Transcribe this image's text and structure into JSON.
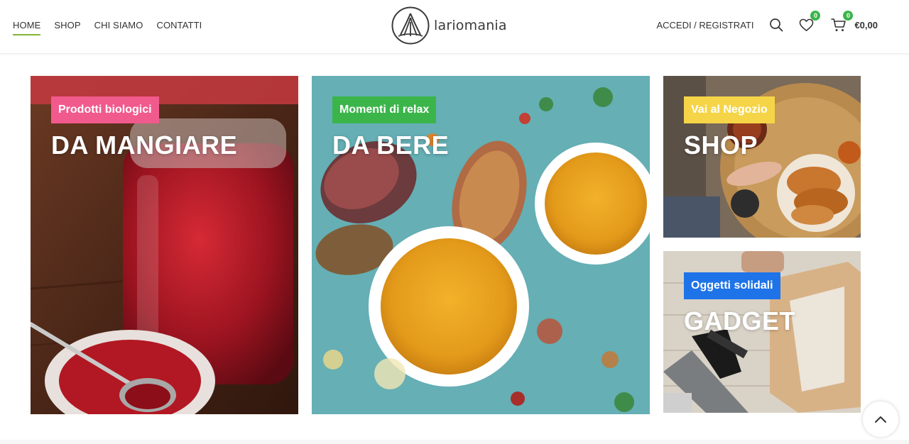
{
  "header": {
    "nav": [
      {
        "label": "HOME",
        "active": true
      },
      {
        "label": "SHOP",
        "active": false
      },
      {
        "label": "CHI SIAMO",
        "active": false
      },
      {
        "label": "CONTATTI",
        "active": false
      }
    ],
    "logo_text": "lariomania",
    "login_label": "ACCEDI / REGISTRATI",
    "wishlist_count": "0",
    "cart_count": "0",
    "cart_total": "€0,00",
    "icons": [
      "search-icon",
      "heart-icon",
      "cart-icon"
    ]
  },
  "banners": [
    {
      "tag": "Prodotti biologici",
      "title": "DA MANGIARE",
      "tag_color": "#f15a8c"
    },
    {
      "tag": "Momenti di relax",
      "title": "DA BERE",
      "tag_color": "#3bb54a"
    },
    {
      "tag": "Vai al Negozio",
      "title": "SHOP",
      "tag_color": "#f5d547"
    },
    {
      "tag": "Oggetti solidali",
      "title": "GADGET",
      "tag_color": "#1e73e8"
    }
  ],
  "colors": {
    "accent": "#83b735",
    "badge": "#3bb54a"
  }
}
